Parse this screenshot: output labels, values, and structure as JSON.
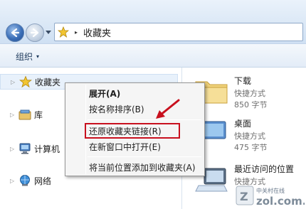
{
  "address_bar": {
    "path_separator": "▸",
    "location": "收藏夹"
  },
  "toolbar": {
    "organize_label": "组织",
    "organize_caret": "▾"
  },
  "navigation": {
    "items": [
      {
        "label": "收藏夹",
        "icon": "star-icon"
      },
      {
        "label": "库",
        "icon": "library-icon"
      },
      {
        "label": "计算机",
        "icon": "computer-icon"
      },
      {
        "label": "网络",
        "icon": "network-icon"
      }
    ]
  },
  "content": {
    "files": [
      {
        "name": "下载",
        "type": "快捷方式",
        "size": "850 字节",
        "icon": "folder-icon"
      },
      {
        "name": "桌面",
        "type": "快捷方式",
        "size": "475 字节",
        "icon": "desktop-icon"
      },
      {
        "name": "最近访问的位置",
        "type": "快捷方式",
        "size": "",
        "icon": "recent-places-icon"
      }
    ]
  },
  "context_menu": {
    "items": [
      {
        "label": "展开(A)",
        "bold": true
      },
      {
        "label": "按名称排序(B)"
      },
      {
        "label": "还原收藏夹链接(R)",
        "highlighted": true
      },
      {
        "label": "在新窗口中打开(E)"
      },
      {
        "label": "将当前位置添加到收藏夹(A)"
      }
    ]
  },
  "colors": {
    "highlight_border": "#c8101e",
    "arrow": "#c8101e",
    "accent": "#3b6fb8"
  }
}
